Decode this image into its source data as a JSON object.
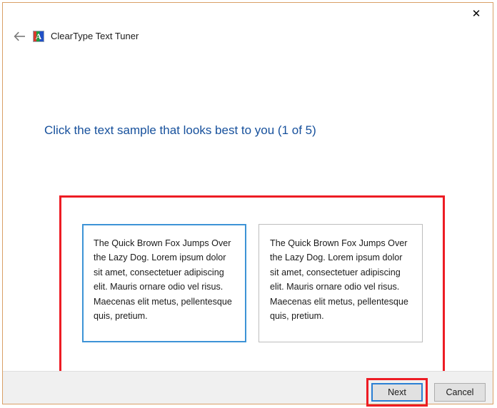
{
  "window": {
    "titlebar": {
      "close_label": "✕",
      "close_icon": "close-icon"
    },
    "nav": {
      "back_icon": "back-arrow-icon",
      "back_label": "←",
      "app_icon": "cleartype-icon",
      "app_icon_glyph": "A",
      "title": "ClearType Text Tuner"
    }
  },
  "main": {
    "heading": "Click the text sample that looks best to you (1 of 5)",
    "samples": [
      {
        "id": "sample-1",
        "selected": true,
        "text": "The Quick Brown Fox Jumps Over the Lazy Dog. Lorem ipsum dolor sit amet, consectetuer adipiscing elit. Mauris ornare odio vel risus. Maecenas elit metus, pellentesque quis, pretium."
      },
      {
        "id": "sample-2",
        "selected": false,
        "text": "The Quick Brown Fox Jumps Over the Lazy Dog. Lorem ipsum dolor sit amet, consectetuer adipiscing elit. Mauris ornare odio vel risus. Maecenas elit metus, pellentesque quis, pretium."
      }
    ]
  },
  "footer": {
    "next_label": "Next",
    "cancel_label": "Cancel"
  },
  "colors": {
    "heading_blue": "#16509c",
    "annotation_red": "#ed1c24",
    "selection_blue": "#3d93d6",
    "focus_blue": "#2a7fd4",
    "window_border": "#d9a066",
    "footer_bg": "#f0f0f0"
  }
}
